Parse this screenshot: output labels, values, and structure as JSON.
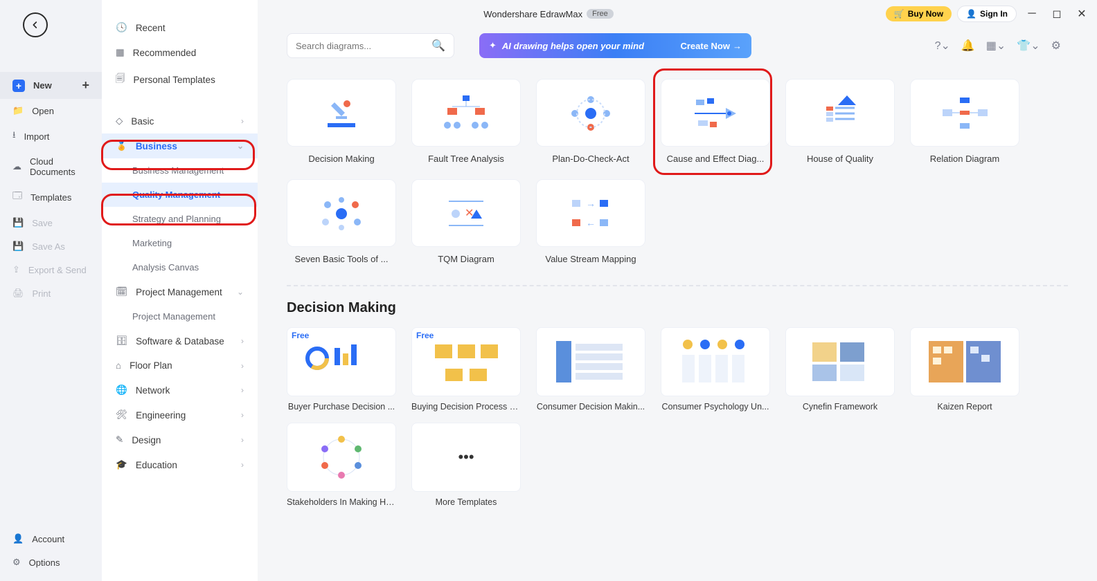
{
  "titlebar": {
    "app": "Wondershare EdrawMax",
    "badge": "Free",
    "buy": "Buy Now",
    "signin": "Sign In"
  },
  "leftbar": {
    "new": "New",
    "open": "Open",
    "import": "Import",
    "cloud": "Cloud Documents",
    "templates": "Templates",
    "save": "Save",
    "saveas": "Save As",
    "export": "Export & Send",
    "print": "Print",
    "account": "Account",
    "options": "Options"
  },
  "categories": {
    "recent": "Recent",
    "recommended": "Recommended",
    "personal": "Personal Templates",
    "basic": "Basic",
    "business": "Business",
    "business_sub": {
      "mgmt": "Business Management",
      "quality": "Quality Management",
      "strategy": "Strategy and Planning",
      "marketing": "Marketing",
      "canvas": "Analysis Canvas"
    },
    "project": "Project Management",
    "project_sub": {
      "pm": "Project Management"
    },
    "software": "Software & Database",
    "floor": "Floor Plan",
    "network": "Network",
    "engineering": "Engineering",
    "design": "Design",
    "education": "Education"
  },
  "search": {
    "placeholder": "Search diagrams..."
  },
  "ai_banner": {
    "text": "AI drawing helps open your mind",
    "cta": "Create Now"
  },
  "templates": [
    "Decision Making",
    "Fault Tree Analysis",
    "Plan-Do-Check-Act",
    "Cause and Effect Diag...",
    "House of Quality",
    "Relation Diagram",
    "Seven Basic Tools of ...",
    "TQM Diagram",
    "Value Stream Mapping"
  ],
  "section_heading": "Decision Making",
  "examples_row1": [
    {
      "free": true,
      "label": "Buyer Purchase Decision ..."
    },
    {
      "free": true,
      "label": "Buying Decision Process O..."
    },
    {
      "free": false,
      "label": "Consumer Decision Makin..."
    },
    {
      "free": false,
      "label": "Consumer Psychology Un..."
    },
    {
      "free": false,
      "label": "Cynefin Framework"
    },
    {
      "free": false,
      "label": "Kaizen Report"
    }
  ],
  "examples_row2": [
    {
      "free": false,
      "label": "Stakeholders In Making He..."
    },
    {
      "free": false,
      "label": "More Templates",
      "more": true
    }
  ]
}
